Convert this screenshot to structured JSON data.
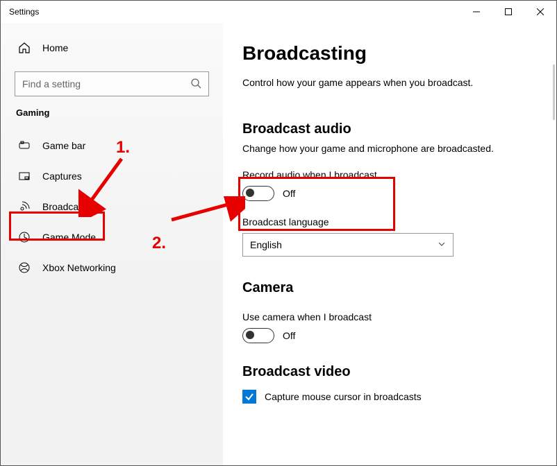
{
  "window_title": "Settings",
  "home_label": "Home",
  "search": {
    "placeholder": "Find a setting"
  },
  "sidebar": {
    "section": "Gaming",
    "items": [
      {
        "label": "Game bar"
      },
      {
        "label": "Captures"
      },
      {
        "label": "Broadcasting"
      },
      {
        "label": "Game Mode"
      },
      {
        "label": "Xbox Networking"
      }
    ]
  },
  "page": {
    "title": "Broadcasting",
    "description": "Control how your game appears when you broadcast."
  },
  "audio": {
    "heading": "Broadcast audio",
    "description": "Change how your game and microphone are broadcasted.",
    "record_label": "Record audio when I broadcast",
    "record_state": "Off",
    "language_label": "Broadcast language",
    "language_value": "English"
  },
  "camera": {
    "heading": "Camera",
    "use_label": "Use camera when I broadcast",
    "use_state": "Off"
  },
  "video": {
    "heading": "Broadcast video",
    "capture_cursor_label": "Capture mouse cursor in broadcasts"
  },
  "annotations": {
    "step1": "1.",
    "step2": "2."
  }
}
